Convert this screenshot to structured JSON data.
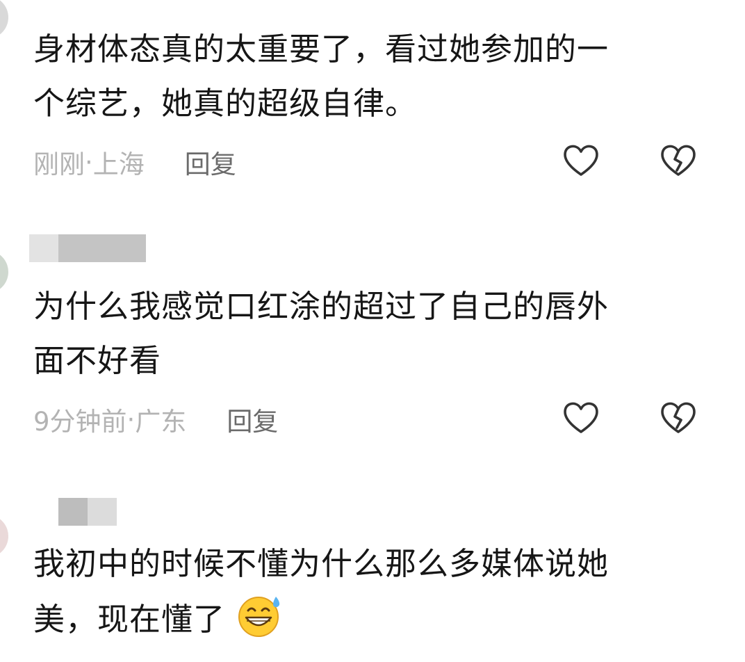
{
  "comments": [
    {
      "text_lines": [
        "身材体态真的太重要了，看过她参加的一",
        "个综艺，她真的超级自律。"
      ],
      "time": "刚刚",
      "location": "上海",
      "separator": " · ",
      "reply": "回复"
    },
    {
      "text_lines": [
        "为什么我感觉口红涂的超过了自己的唇外",
        "面不好看"
      ],
      "time": "9分钟前",
      "location": "广东",
      "separator": " · ",
      "reply": "回复"
    },
    {
      "text_lines": [
        "我初中的时候不懂为什么那么多媒体说她",
        "美，现在懂了"
      ],
      "emoji": "grinning-sweat-emoji"
    }
  ],
  "icons": {
    "like": "heart-outline-icon",
    "dislike": "broken-heart-icon"
  },
  "colors": {
    "text": "#161616",
    "meta": "#b3b3b3",
    "reply": "#6b6b6b",
    "icon": "#333333"
  }
}
